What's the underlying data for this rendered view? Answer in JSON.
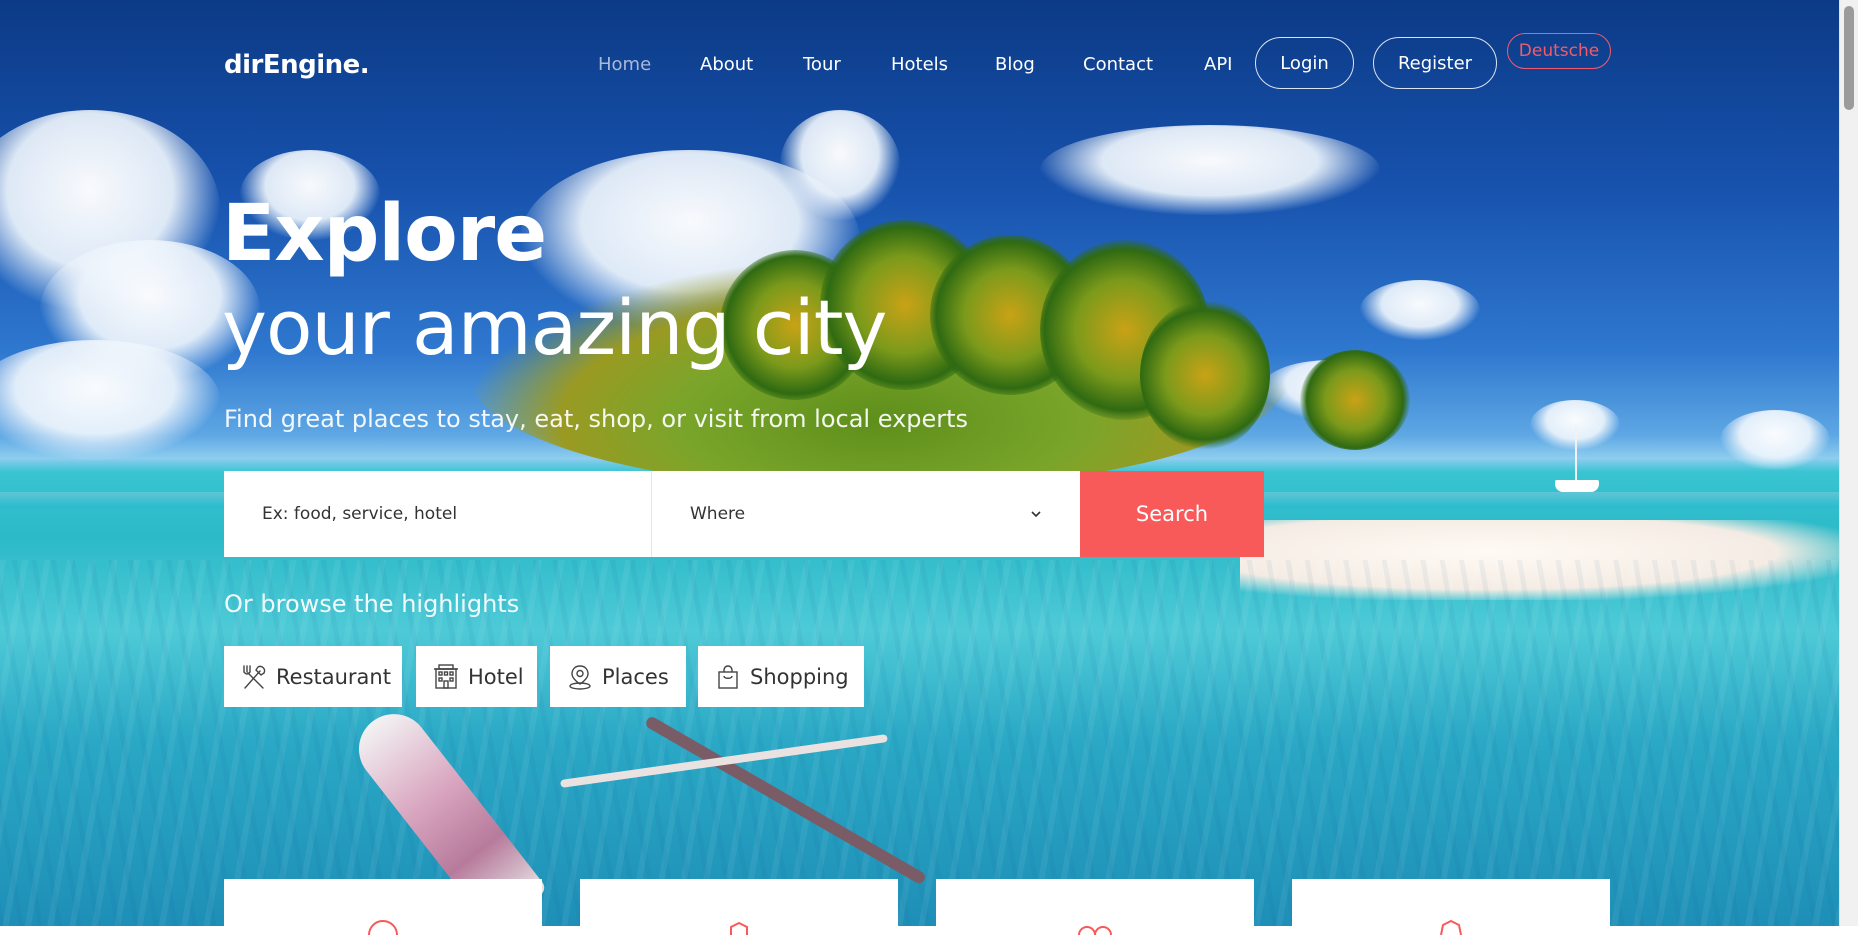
{
  "navbar": {
    "brand": "dirEngine.",
    "links": [
      {
        "label": "Home",
        "active": true
      },
      {
        "label": "About"
      },
      {
        "label": "Tour"
      },
      {
        "label": "Hotels"
      },
      {
        "label": "Blog"
      },
      {
        "label": "Contact"
      },
      {
        "label": "API"
      }
    ],
    "login_label": "Login",
    "register_label": "Register",
    "language_label": "Deutsche"
  },
  "hero": {
    "title_bold": "Explore",
    "title_light": "your amazing city",
    "subtitle": "Find great places to stay, eat, shop, or visit from local experts"
  },
  "search": {
    "query_placeholder": "Ex: food, service, hotel",
    "where_label": "Where",
    "button_label": "Search"
  },
  "browse": {
    "label": "Or browse the highlights",
    "chips": [
      {
        "label": "Restaurant",
        "icon": "restaurant-icon"
      },
      {
        "label": "Hotel",
        "icon": "hotel-icon"
      },
      {
        "label": "Places",
        "icon": "places-icon"
      },
      {
        "label": "Shopping",
        "icon": "shopping-icon"
      }
    ]
  },
  "colors": {
    "accent": "#f85959",
    "language_accent": "#f35b6a",
    "nav_active": "#a9b9d9"
  }
}
